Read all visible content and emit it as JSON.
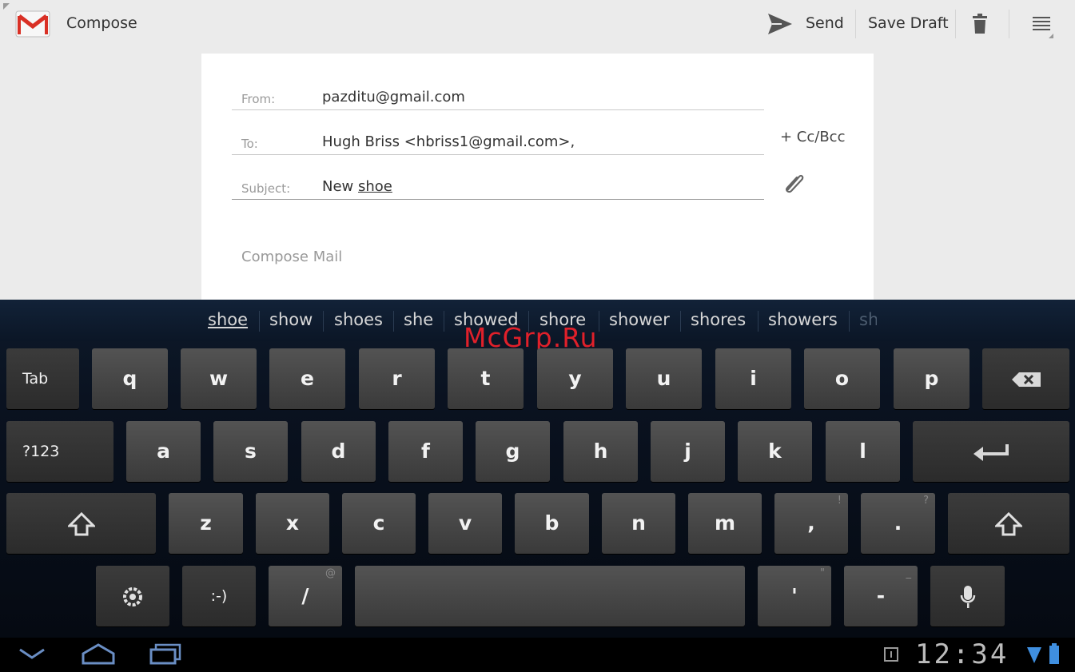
{
  "actionbar": {
    "title": "Compose",
    "send_label": "Send",
    "save_draft_label": "Save Draft"
  },
  "compose": {
    "from_label": "From:",
    "from_value": "pazditu@gmail.com",
    "to_label": "To:",
    "to_value": "Hugh Briss <hbriss1@gmail.com>,",
    "cc_bcc_label": "+ Cc/Bcc",
    "subject_label": "Subject:",
    "subject_prefix": "New",
    "subject_word": "shoe",
    "body_placeholder": "Compose Mail"
  },
  "suggestions": [
    "shoe",
    "show",
    "shoes",
    "she",
    "showed",
    "shore",
    "shower",
    "shores",
    "showers",
    "sh"
  ],
  "watermark": "McGrp.Ru",
  "keyboard": {
    "row1": [
      "Tab",
      "q",
      "w",
      "e",
      "r",
      "t",
      "y",
      "u",
      "i",
      "o",
      "p"
    ],
    "row2": [
      "?123",
      "a",
      "s",
      "d",
      "f",
      "g",
      "h",
      "j",
      "k",
      "l"
    ],
    "row3": [
      "z",
      "x",
      "c",
      "v",
      "b",
      "n",
      "m",
      ",",
      "."
    ],
    "row3_hints": [
      "!",
      "?"
    ],
    "row4": [
      ":-)",
      "/",
      "'",
      "-"
    ],
    "row4_hints": [
      "@",
      "\"",
      "_"
    ]
  },
  "status": {
    "time": "12:34"
  },
  "colors": {
    "gmail_red": "#d93025",
    "keyboard_bg": "#0a1220",
    "key_face": "#474747",
    "battery_blue": "#3f8fe0"
  }
}
